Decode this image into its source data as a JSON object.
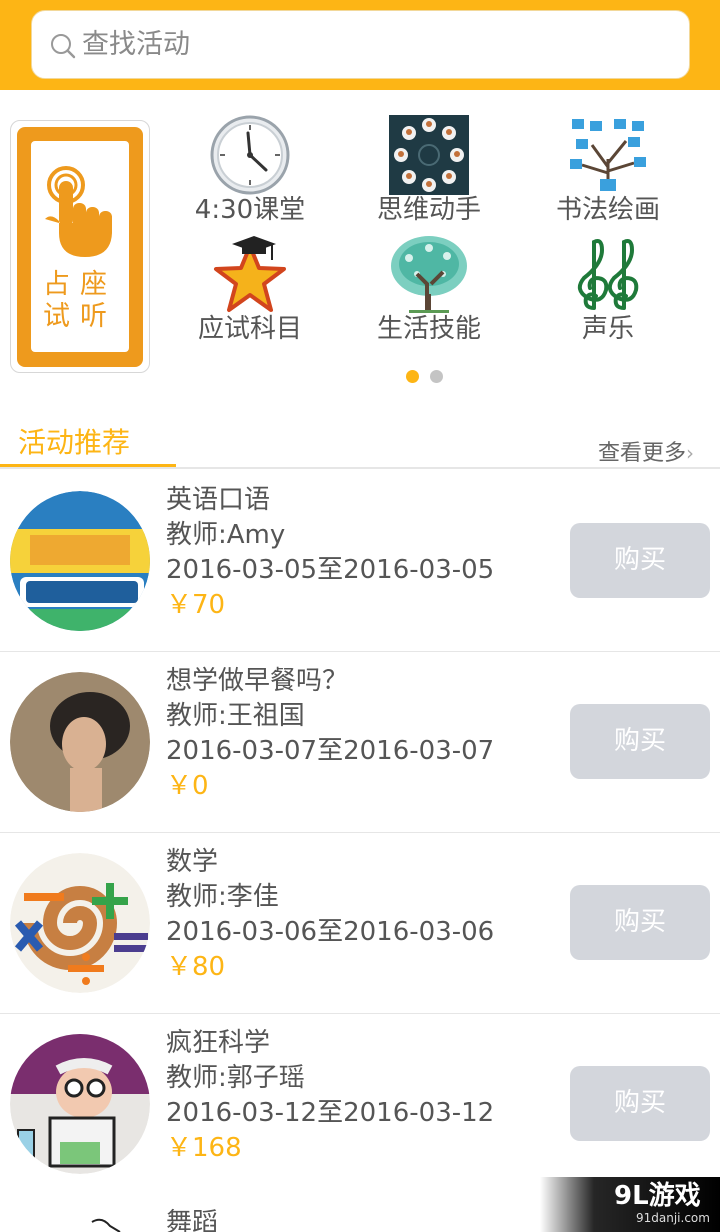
{
  "header": {
    "search_placeholder": "查找活动"
  },
  "promo": {
    "line1": "占座",
    "line2": "试听"
  },
  "categories": [
    {
      "label": "4:30课堂",
      "icon": "clock-icon"
    },
    {
      "label": "思维动手",
      "icon": "network-people-icon"
    },
    {
      "label": "书法绘画",
      "icon": "tree-people-icon"
    },
    {
      "label": "应试科目",
      "icon": "graduation-star-icon"
    },
    {
      "label": "生活技能",
      "icon": "green-tree-icon"
    },
    {
      "label": "声乐",
      "icon": "treble-clef-icon"
    }
  ],
  "pager": {
    "count": 2,
    "active": 0
  },
  "section": {
    "title": "活动推荐",
    "more": "查看更多"
  },
  "activities": [
    {
      "title": "英语口语",
      "teacher": "教师:Amy",
      "date": "2016-03-05至2016-03-05",
      "price": "￥70",
      "buy": "购买",
      "thumb": "english-poster"
    },
    {
      "title": "想学做早餐吗？",
      "teacher": "教师:王祖国",
      "date": "2016-03-07至2016-03-07",
      "price": "￥0",
      "buy": "购买",
      "thumb": "person-photo"
    },
    {
      "title": "数学",
      "teacher": "教师:李佳",
      "date": "2016-03-06至2016-03-06",
      "price": "￥80",
      "buy": "购买",
      "thumb": "math-symbols"
    },
    {
      "title": "疯狂科学",
      "teacher": "教师:郭子瑶",
      "date": "2016-03-12至2016-03-12",
      "price": "￥168",
      "buy": "购买",
      "thumb": "mad-scientist"
    },
    {
      "title": "舞蹈"
    }
  ],
  "watermark": {
    "logo": "9L游戏",
    "url": "91danji.com"
  },
  "colors": {
    "accent": "#FDB515",
    "promo": "#EE9A1D",
    "button": "#D3D6DC"
  }
}
